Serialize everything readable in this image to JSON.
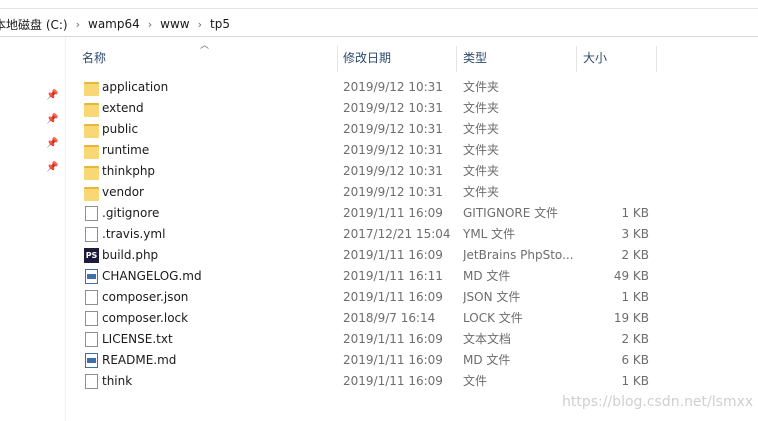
{
  "breadcrumb": [
    "本地磁盘 (C:)",
    "wamp64",
    "www",
    "tp5"
  ],
  "columns": {
    "name": "名称",
    "date": "修改日期",
    "type": "类型",
    "size": "大小"
  },
  "files": [
    {
      "name": "application",
      "date": "2019/9/12 10:31",
      "type": "文件夹",
      "size": "",
      "icon": "folder"
    },
    {
      "name": "extend",
      "date": "2019/9/12 10:31",
      "type": "文件夹",
      "size": "",
      "icon": "folder"
    },
    {
      "name": "public",
      "date": "2019/9/12 10:31",
      "type": "文件夹",
      "size": "",
      "icon": "folder"
    },
    {
      "name": "runtime",
      "date": "2019/9/12 10:31",
      "type": "文件夹",
      "size": "",
      "icon": "folder"
    },
    {
      "name": "thinkphp",
      "date": "2019/9/12 10:31",
      "type": "文件夹",
      "size": "",
      "icon": "folder"
    },
    {
      "name": "vendor",
      "date": "2019/9/12 10:31",
      "type": "文件夹",
      "size": "",
      "icon": "folder"
    },
    {
      "name": ".gitignore",
      "date": "2019/1/11 16:09",
      "type": "GITIGNORE 文件",
      "size": "1 KB",
      "icon": "file"
    },
    {
      "name": ".travis.yml",
      "date": "2017/12/21 15:04",
      "type": "YML 文件",
      "size": "3 KB",
      "icon": "file"
    },
    {
      "name": "build.php",
      "date": "2019/1/11 16:09",
      "type": "JetBrains PhpSto...",
      "size": "2 KB",
      "icon": "phpstorm"
    },
    {
      "name": "CHANGELOG.md",
      "date": "2019/1/11 16:11",
      "type": "MD 文件",
      "size": "49 KB",
      "icon": "md"
    },
    {
      "name": "composer.json",
      "date": "2019/1/11 16:09",
      "type": "JSON 文件",
      "size": "1 KB",
      "icon": "file"
    },
    {
      "name": "composer.lock",
      "date": "2018/9/7 16:14",
      "type": "LOCK 文件",
      "size": "19 KB",
      "icon": "file"
    },
    {
      "name": "LICENSE.txt",
      "date": "2019/1/11 16:09",
      "type": "文本文档",
      "size": "2 KB",
      "icon": "file"
    },
    {
      "name": "README.md",
      "date": "2019/1/11 16:09",
      "type": "MD 文件",
      "size": "6 KB",
      "icon": "md"
    },
    {
      "name": "think",
      "date": "2019/1/11 16:09",
      "type": "文件",
      "size": "1 KB",
      "icon": "file"
    }
  ],
  "icons": {
    "phpstorm_label": "PS"
  },
  "watermark": "https://blog.csdn.net/lsmxx"
}
